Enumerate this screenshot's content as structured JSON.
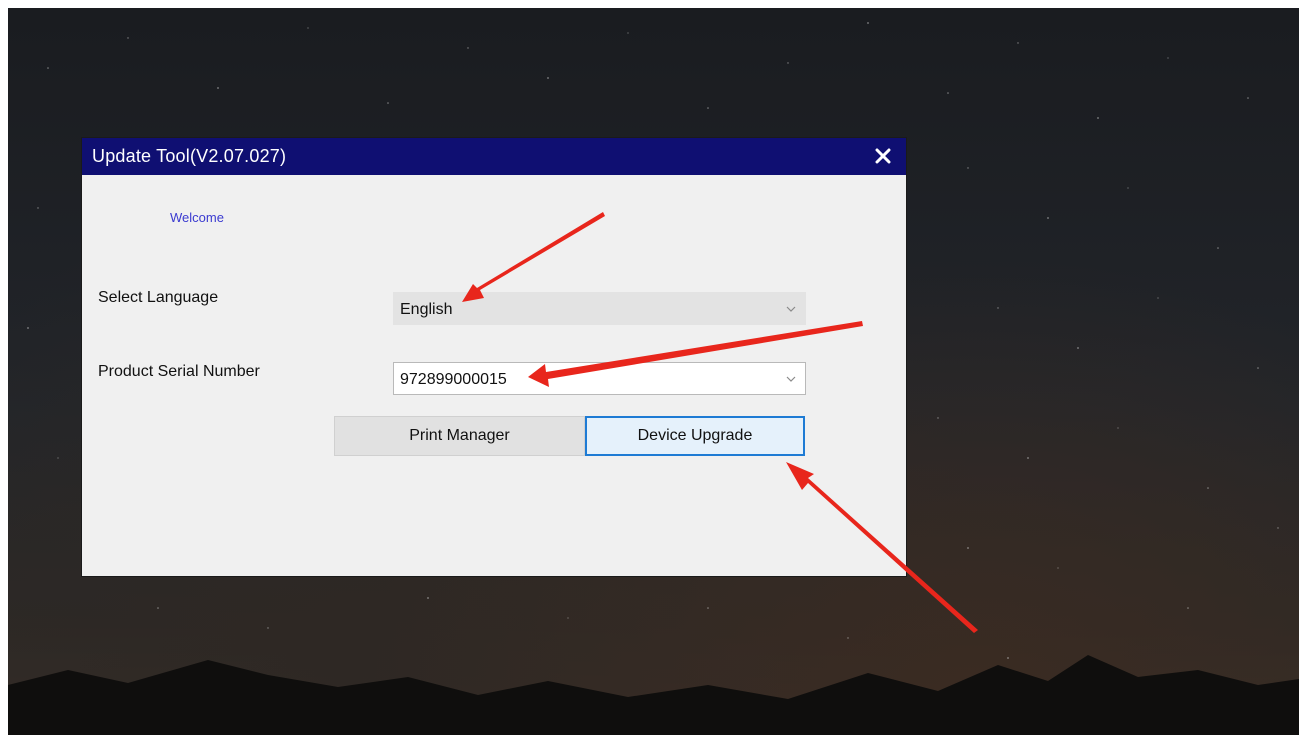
{
  "window": {
    "title": "Update Tool(V2.07.027)",
    "welcome": "Welcome",
    "labels": {
      "language": "Select Language",
      "serial": "Product Serial Number"
    },
    "language_value": "English",
    "serial_value": "972899000015",
    "buttons": {
      "print_manager": "Print Manager",
      "device_upgrade": "Device Upgrade"
    }
  },
  "colors": {
    "titlebar": "#0f0f72",
    "welcome": "#3a3ad0",
    "focus_border": "#1e7bd4",
    "annotation_arrow": "#e8261c"
  },
  "icons": [
    "close-icon",
    "chevron-down-icon"
  ]
}
